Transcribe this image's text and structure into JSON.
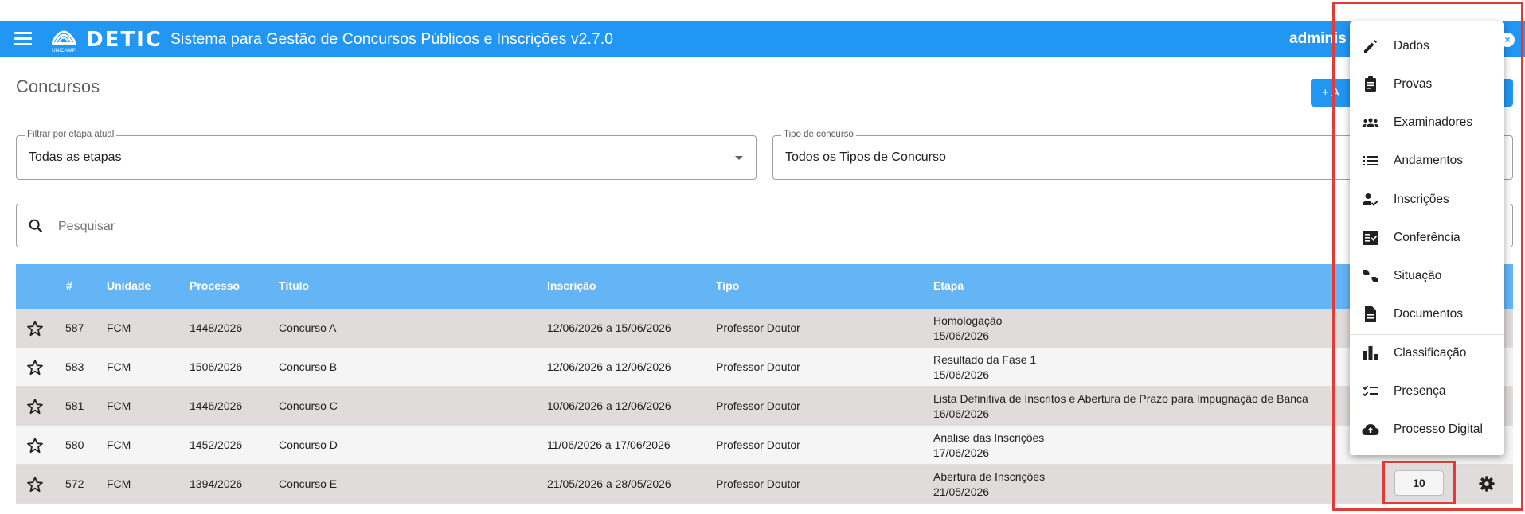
{
  "app": {
    "logo_text": "DETIC",
    "logo_subtext": "UNICAMP",
    "title": "Sistema para Gestão de Concursos Públicos e Inscrições v2.7.0",
    "user": "adminis"
  },
  "page": {
    "title": "Concursos",
    "add_button_label": "+ A"
  },
  "filters": {
    "etapa": {
      "label": "Filtrar por etapa atual",
      "value": "Todas as etapas"
    },
    "tipo": {
      "label": "Tipo de concurso",
      "value": "Todos os Tipos de Concurso"
    }
  },
  "search": {
    "placeholder": "Pesquisar"
  },
  "table": {
    "headers": [
      "#",
      "Unidade",
      "Processo",
      "Título",
      "Inscrição",
      "Tipo",
      "Etapa"
    ],
    "rows": [
      {
        "id": "587",
        "unidade": "FCM",
        "processo": "1448/2026",
        "titulo": "Concurso A",
        "inscricao": "12/06/2026 a 15/06/2026",
        "tipo": "Professor Doutor",
        "etapa": "Homologação",
        "etapa_data": "15/06/2026"
      },
      {
        "id": "583",
        "unidade": "FCM",
        "processo": "1506/2026",
        "titulo": "Concurso B",
        "inscricao": "12/06/2026 a 12/06/2026",
        "tipo": "Professor Doutor",
        "etapa": "Resultado da Fase 1",
        "etapa_data": "15/06/2026"
      },
      {
        "id": "581",
        "unidade": "FCM",
        "processo": "1446/2026",
        "titulo": "Concurso C",
        "inscricao": "10/06/2026 a 12/06/2026",
        "tipo": "Professor Doutor",
        "etapa": "Lista Definitiva de Inscritos e Abertura de Prazo para Impugnação de Banca",
        "etapa_data": "16/06/2026"
      },
      {
        "id": "580",
        "unidade": "FCM",
        "processo": "1452/2026",
        "titulo": "Concurso D",
        "inscricao": "11/06/2026 a 17/06/2026",
        "tipo": "Professor Doutor",
        "etapa": "Analise das Inscrições",
        "etapa_data": "17/06/2026"
      },
      {
        "id": "572",
        "unidade": "FCM",
        "processo": "1394/2026",
        "titulo": "Concurso E",
        "inscricao": "21/05/2026 a 28/05/2026",
        "tipo": "Professor Doutor",
        "etapa": "Abertura de Inscrições",
        "etapa_data": "21/05/2026"
      }
    ]
  },
  "pagination": {
    "per_page": "10"
  },
  "menu": {
    "items": [
      {
        "label": "Dados",
        "icon": "pencil-icon"
      },
      {
        "label": "Provas",
        "icon": "clipboard-icon"
      },
      {
        "label": "Examinadores",
        "icon": "group-icon"
      },
      {
        "label": "Andamentos",
        "icon": "list-icon"
      },
      {
        "label": "Inscrições",
        "icon": "person-check-icon"
      },
      {
        "label": "Conferência",
        "icon": "fact-check-icon"
      },
      {
        "label": "Situação",
        "icon": "thumbs-up-down-icon"
      },
      {
        "label": "Documentos",
        "icon": "document-icon"
      },
      {
        "label": "Classificação",
        "icon": "bar-chart-icon"
      },
      {
        "label": "Presença",
        "icon": "checklist-icon"
      },
      {
        "label": "Processo Digital",
        "icon": "cloud-upload-icon"
      }
    ]
  },
  "colors": {
    "primary": "#2196f3",
    "header_row": "#64b5f6",
    "highlight": "#e53935"
  }
}
